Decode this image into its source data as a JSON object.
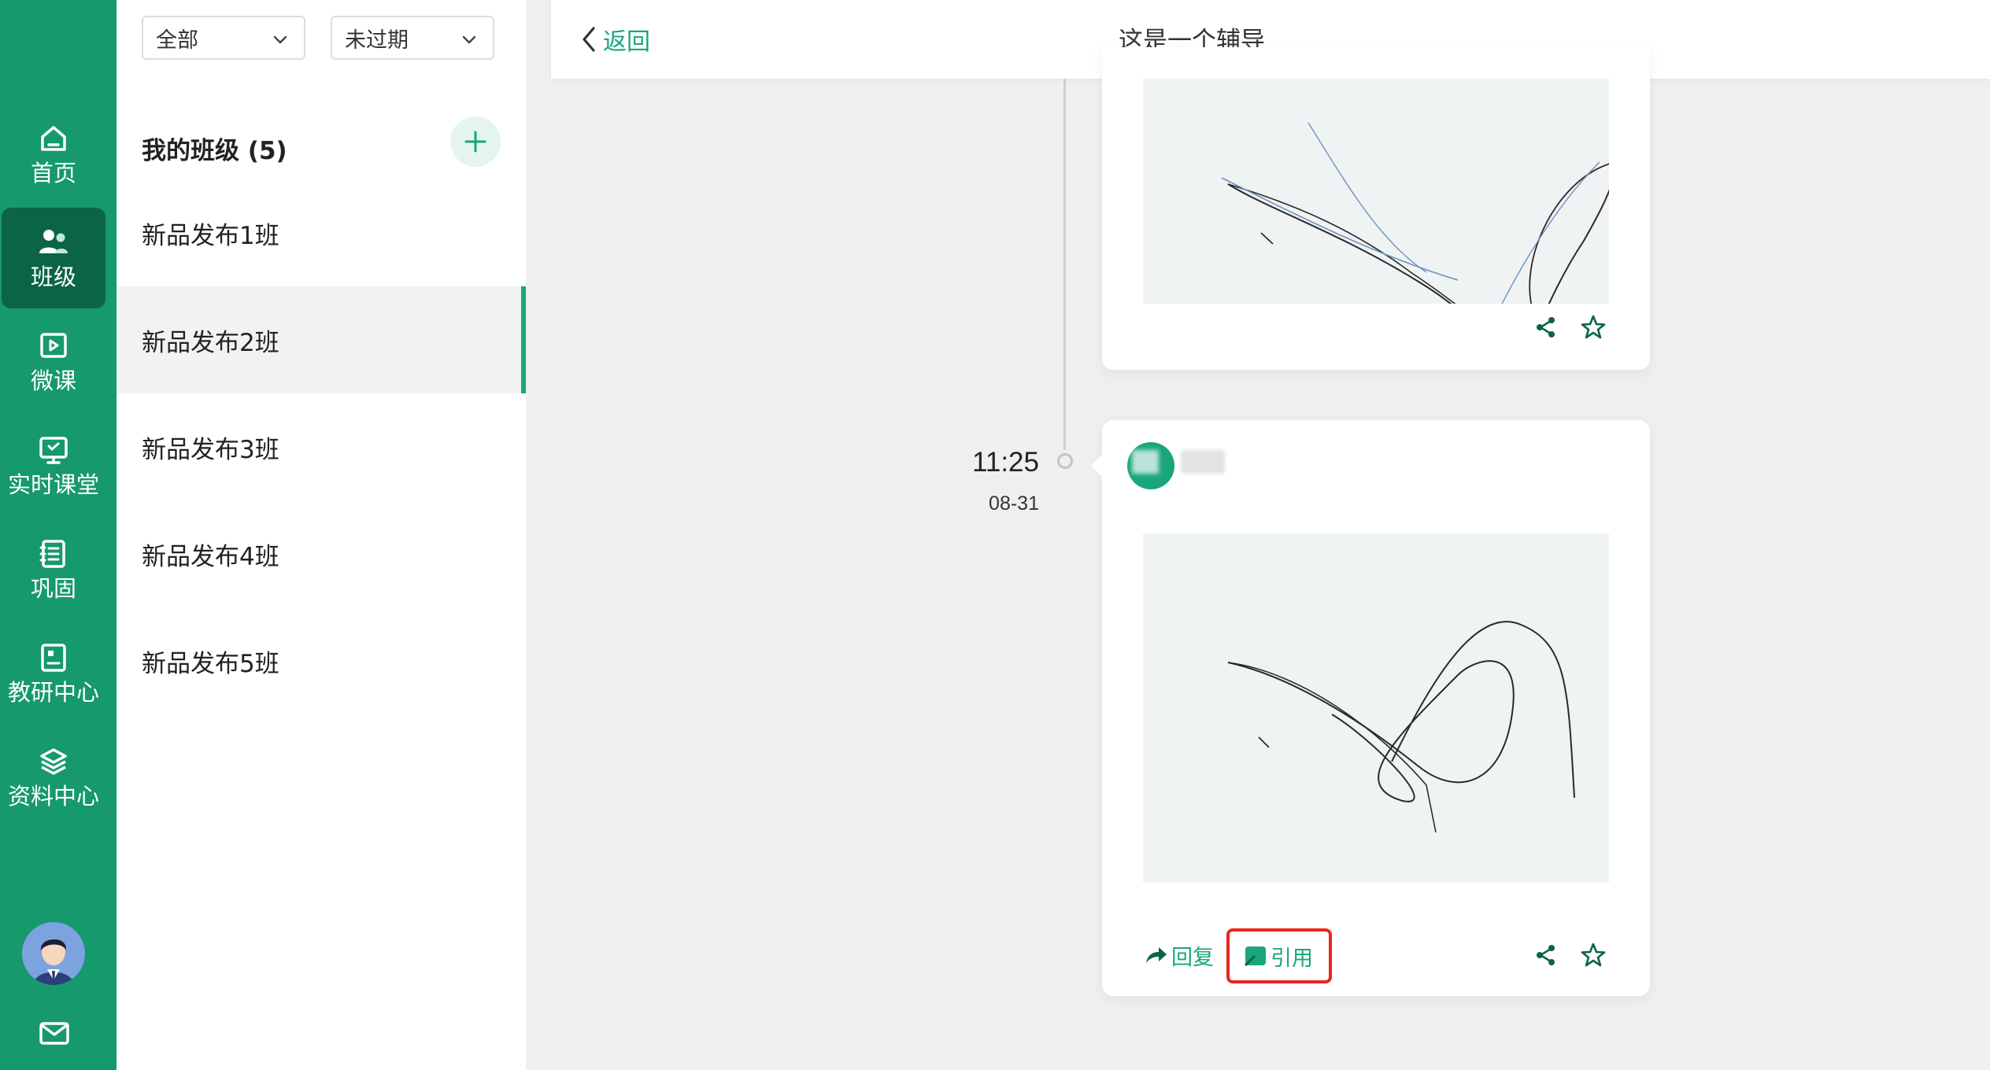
{
  "nav": {
    "items": [
      {
        "label": "首页",
        "icon": "home-icon"
      },
      {
        "label": "班级",
        "icon": "users-icon",
        "active": true
      },
      {
        "label": "微课",
        "icon": "video-icon"
      },
      {
        "label": "实时课堂",
        "icon": "presentation-icon"
      },
      {
        "label": "巩固",
        "icon": "notebook-icon"
      },
      {
        "label": "教研中心",
        "icon": "research-icon"
      },
      {
        "label": "资料中心",
        "icon": "layers-icon"
      }
    ],
    "mail_icon": "mail-icon"
  },
  "filters": {
    "scope": "全部",
    "status": "未过期"
  },
  "classes": {
    "title": "我的班级 (5)",
    "items": [
      "新品发布1班",
      "新品发布2班",
      "新品发布3班",
      "新品发布4班",
      "新品发布5班"
    ],
    "selected": "新品发布2班"
  },
  "header": {
    "back_label": "返回",
    "title": "这是一个辅导"
  },
  "timeline": {
    "time": "11:25",
    "date": "08-31"
  },
  "post": {
    "reply_label": "回复",
    "quote_label": "引用"
  },
  "colors": {
    "brand": "#16996b",
    "brand_dark": "#0c6448",
    "accent": "#1aa57c",
    "highlight": "#e8271b"
  }
}
